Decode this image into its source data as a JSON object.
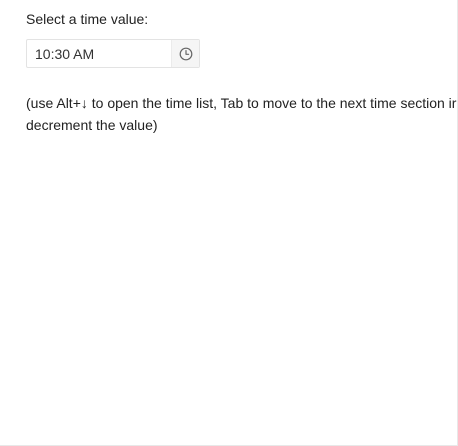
{
  "label": "Select a time value:",
  "timepicker": {
    "value": "10:30 AM",
    "icon": "clock-icon"
  },
  "hint": {
    "line1": "(use Alt+↓ to open the time list, Tab to move to the next time section ir",
    "line2": "decrement the value)"
  },
  "colors": {
    "text": "#222222",
    "border": "#e3e3e3",
    "button_bg": "#f5f5f5",
    "icon": "#666666"
  }
}
